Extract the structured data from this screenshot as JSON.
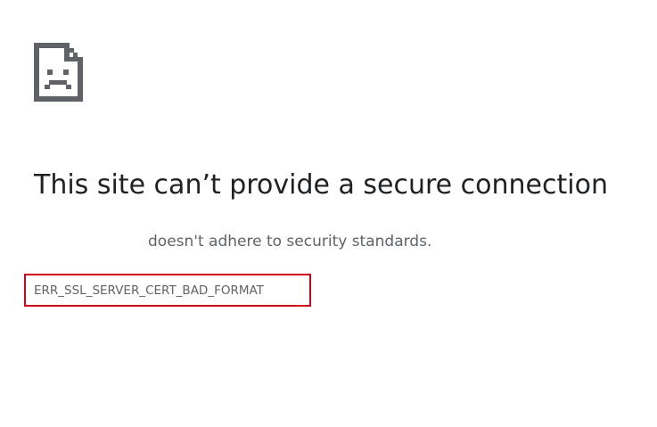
{
  "page": {
    "icon": "broken-page-sad-face-icon",
    "heading": "This site can’t provide a secure connection",
    "explanation": "doesn't adhere to security standards.",
    "error_code": "ERR_SSL_SERVER_CERT_BAD_FORMAT",
    "colors": {
      "heading": "#202124",
      "secondary_text": "#5f6368",
      "highlight_box": "#d0021b",
      "icon": "#5f6368"
    }
  }
}
